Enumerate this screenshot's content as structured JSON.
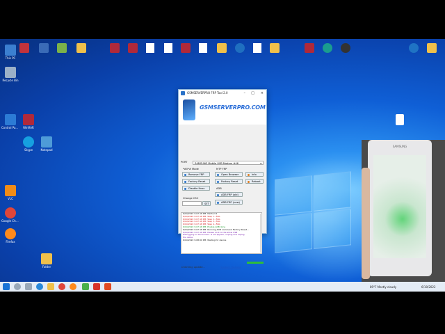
{
  "colors": {
    "accent": "#2c6fd8",
    "log_red": "#d62020",
    "log_green": "#1c9a2a",
    "log_purple": "#7a1fb0"
  },
  "desktop_icons": [
    {
      "label": "This PC",
      "color": "#3b7fd0"
    },
    {
      "label": "Recycle Bin",
      "color": "#9bb0c8"
    },
    {
      "label": "Google Chrome",
      "color": "#e0463a"
    },
    {
      "label": "Firefox",
      "color": "#ff8a1c"
    },
    {
      "label": "VLC",
      "color": "#f28c16"
    },
    {
      "label": "Control Panel",
      "color": "#2c7bd5"
    },
    {
      "label": "WinRAR",
      "color": "#b0293a"
    },
    {
      "label": "Skype",
      "color": "#16a0e0"
    },
    {
      "label": "Notepad",
      "color": "#4e9bd8"
    },
    {
      "label": "Folder",
      "color": "#f0c04a"
    }
  ],
  "app": {
    "title": "GSMSERVERPRO FRP Tool 2.0",
    "brand": "GSMSERVERPRO.COM",
    "port_label": "PORT",
    "port_value": "SAMSUNG Mobile USB Modem #46",
    "mode_label": "*#0*# Mode",
    "mtp_label": "MTP FRP",
    "btn_remove": "Remove FRP",
    "btn_open": "Open Browser",
    "btn_info": "Info",
    "btn_factory1": "Factory Reset",
    "btn_factory2": "Factory Reset",
    "btn_reboot": "Reboot",
    "btn_knox": "Disable Knox",
    "adb_label": "ADB",
    "btn_adb_old": "ADB FRP (old)",
    "btn_adb_new": "ADB FRP (new)",
    "csc_label": "Change CSC",
    "csc_set": "SET",
    "log": [
      {
        "text": "6/10/2022 9:07:18 PM: Method 2",
        "color": "#111"
      },
      {
        "text": "6/10/2022 9:07:18 PM: Step 1...FAIL",
        "color": "#d62020"
      },
      {
        "text": "6/10/2022 9:07:18 PM: Step 2...FAIL",
        "color": "#d62020"
      },
      {
        "text": "6/10/2022 9:07:18 PM: Step 3...FAIL",
        "color": "#d62020"
      },
      {
        "text": "6/10/2022 9:07:18 PM: Step 4...FAIL",
        "color": "#d62020"
      },
      {
        "text": "6/10/2022 9:07:18 PM: Enable ADB done",
        "color": "#1c9a2a"
      },
      {
        "text": "6/10/2022 9:07:18 PM: Running ADB command Factory Reset...",
        "color": "#111"
      },
      {
        "text": "6/10/2022 9:07:18 PM: Please click to the allow USB",
        "color": "#7a1fb0"
      },
      {
        "text": "Debugging on the screen. If not appear, unplug and replug",
        "color": "#7a1fb0"
      },
      {
        "text": "the cable.",
        "color": "#7a1fb0"
      },
      {
        "text": "6/10/2022 9:08:00 PM: Waiting for device",
        "color": "#111"
      }
    ],
    "status_left": "Checking update...",
    "status_link": "Support Youtube",
    "progress": 1
  },
  "phone": {
    "brand": "SAMSUNG"
  },
  "taskbar": {
    "weather": "89°F Mostly cloudy",
    "date": "6/10/2022"
  }
}
